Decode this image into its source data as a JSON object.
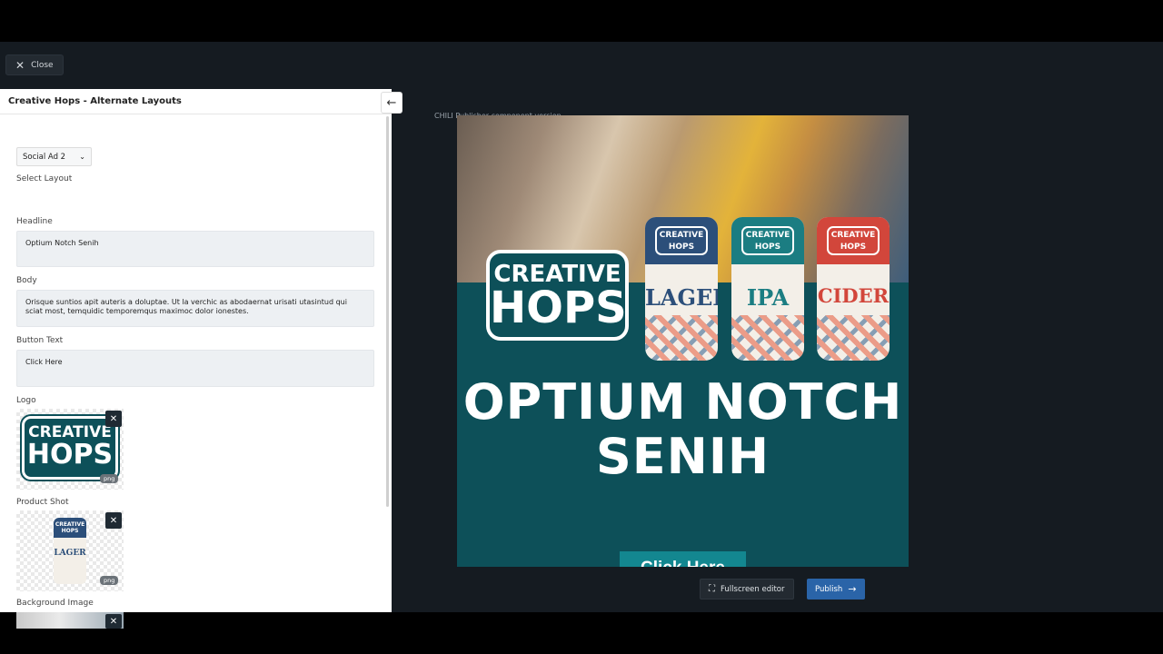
{
  "topbar": {
    "close_label": "Close",
    "close_icon": "close-icon"
  },
  "panel": {
    "title": "Creative Hops - Alternate Layouts",
    "collapse_icon": "arrow-left-icon",
    "select_layout": {
      "label": "Select Layout",
      "value": "Social Ad 2"
    },
    "headline": {
      "label": "Headline",
      "value": "Optium Notch Senih"
    },
    "body": {
      "label": "Body",
      "value": "Orisque suntios apit auteris a doluptae. Ut la verchic as abodaernat urisati utasintud qui sciat most, temquidic temporemqus maximoc dolor ionestes."
    },
    "button_text": {
      "label": "Button Text",
      "value": "Click Here"
    },
    "logo": {
      "label": "Logo",
      "badge": "png",
      "line1": "CREATIVE",
      "line2": "HOPS"
    },
    "product_shot": {
      "label": "Product Shot",
      "badge": "png",
      "can_text": "LAGER",
      "can_badge": "CREATIVE HOPS"
    },
    "background_image": {
      "label": "Background Image"
    }
  },
  "canvas": {
    "label": "CHILI Publisher component version",
    "ad": {
      "logo_line1": "CREATIVE",
      "logo_line2": "HOPS",
      "cans": [
        {
          "name": "LAGER",
          "badge_line1": "CREATIVE",
          "badge_line2": "HOPS",
          "color": "#2c4f7a"
        },
        {
          "name": "IPA",
          "badge_line1": "CREATIVE",
          "badge_line2": "HOPS",
          "color": "#1b7d82"
        },
        {
          "name": "CIDER",
          "badge_line1": "CREATIVE",
          "badge_line2": "HOPS",
          "color": "#d2463b"
        }
      ],
      "headline_line1": "OPTIUM NOTCH",
      "headline_line2": "SENIH",
      "button": "Click Here"
    }
  },
  "footer": {
    "fullscreen_label": "Fullscreen editor",
    "publish_label": "Publish",
    "publish_color": "#2a64a8"
  }
}
